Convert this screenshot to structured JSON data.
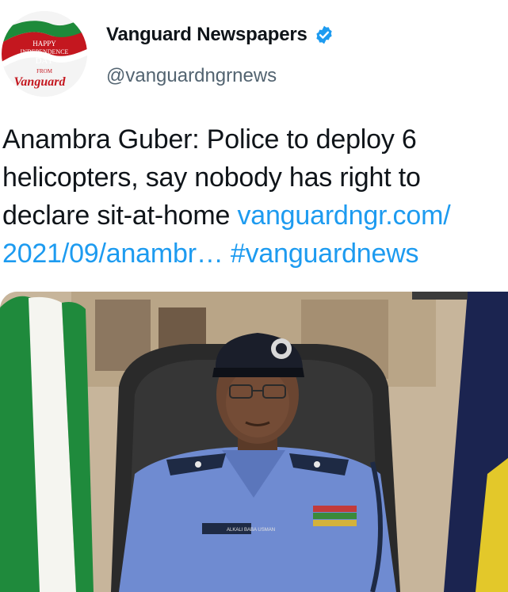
{
  "account": {
    "display_name": "Vanguard Newspapers",
    "handle": "@vanguardngrnews",
    "verified": true,
    "verified_color": "#1d9bf0",
    "avatar": {
      "line1": "HAPPY",
      "line2": "INDEPENDENCE",
      "line3": "DAY",
      "line4": "FROM",
      "logo": "Vanguard"
    }
  },
  "tweet": {
    "text": "Anambra Guber: Police to deploy 6 helicopters, say nobody has right to declare sit-at-home ",
    "link_text": "vanguardngr.com/ 2021/09/anambr…",
    "hashtag": "#vanguardnews",
    "link_color": "#1d9bf0"
  },
  "media": {
    "name_tag": "ALKALI BABA USMAN",
    "icon": "photo-police-officer"
  }
}
